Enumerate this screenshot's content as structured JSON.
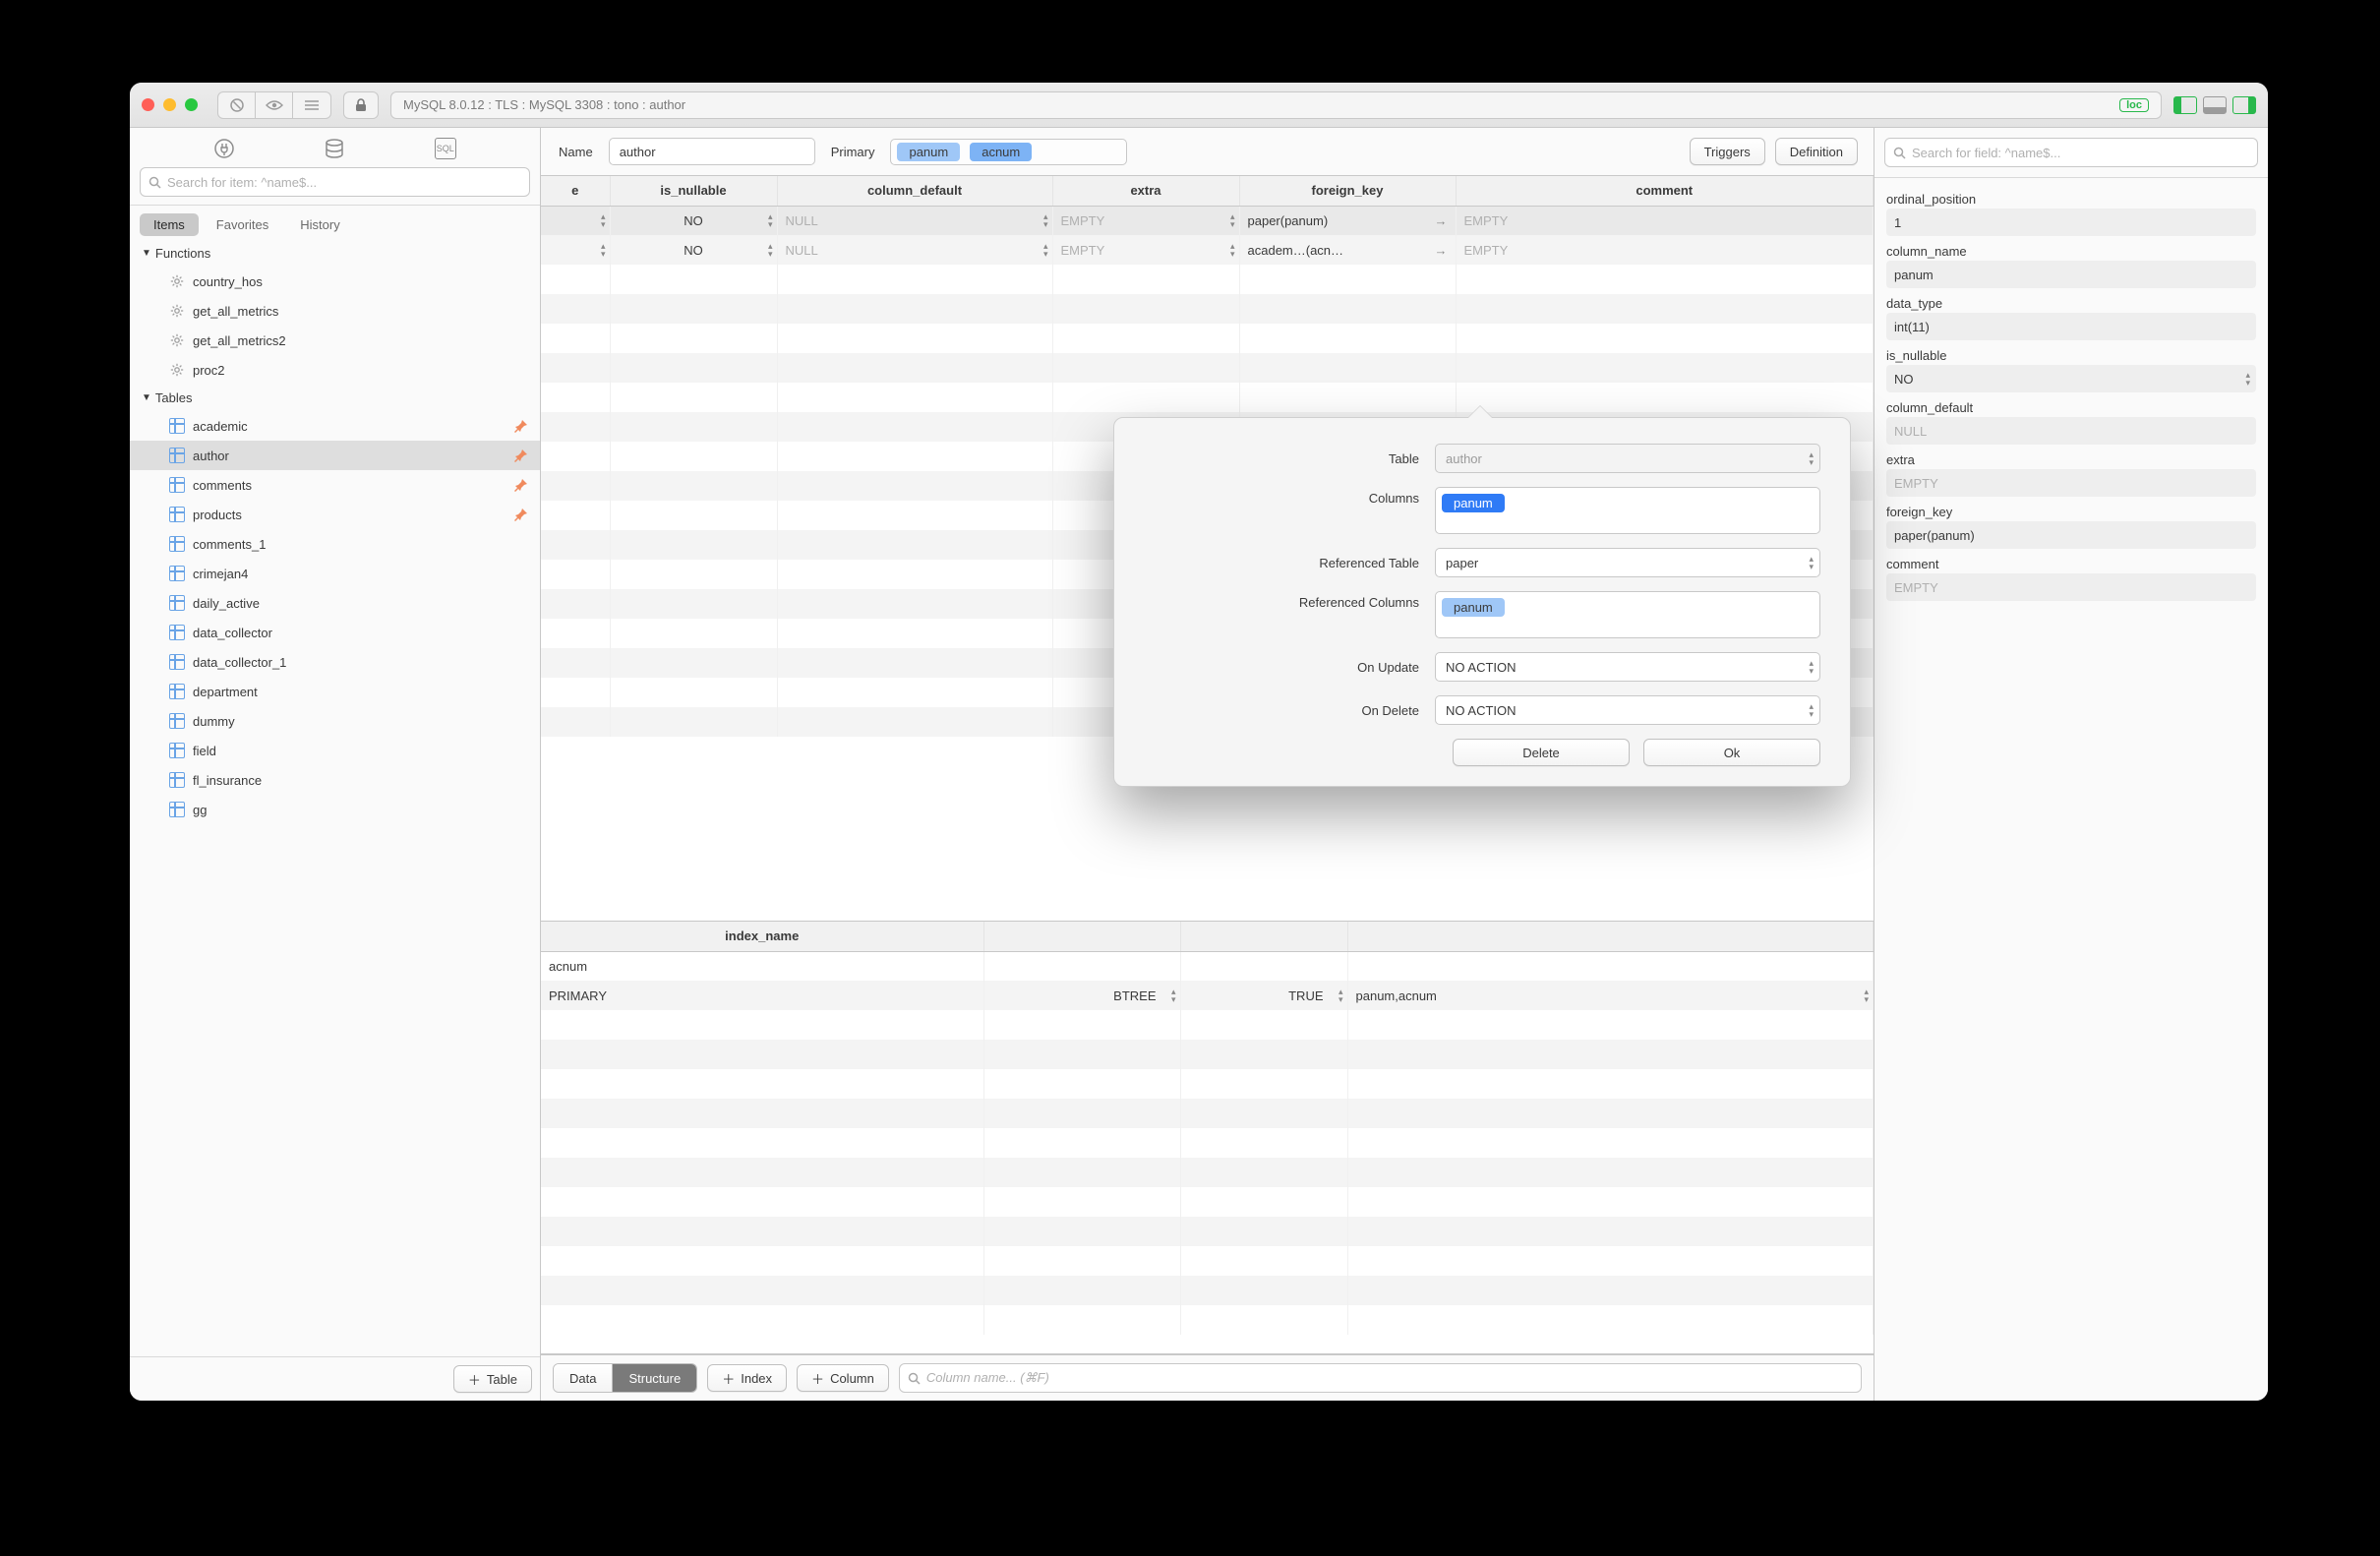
{
  "titlebar": {
    "path": "MySQL 8.0.12 : TLS : MySQL 3308 : tono : author",
    "loc_badge": "loc"
  },
  "sidebar": {
    "search_placeholder": "Search for item: ^name$...",
    "tabs": {
      "items": "Items",
      "favorites": "Favorites",
      "history": "History"
    },
    "functions_header": "Functions",
    "functions": [
      {
        "name": "country_hos"
      },
      {
        "name": "get_all_metrics"
      },
      {
        "name": "get_all_metrics2"
      },
      {
        "name": "proc2"
      }
    ],
    "tables_header": "Tables",
    "tables": [
      {
        "name": "academic",
        "pinned": true
      },
      {
        "name": "author",
        "pinned": true,
        "selected": true
      },
      {
        "name": "comments",
        "pinned": true
      },
      {
        "name": "products",
        "pinned": true
      },
      {
        "name": "comments_1"
      },
      {
        "name": "crimejan4"
      },
      {
        "name": "daily_active"
      },
      {
        "name": "data_collector"
      },
      {
        "name": "data_collector_1"
      },
      {
        "name": "department"
      },
      {
        "name": "dummy"
      },
      {
        "name": "field"
      },
      {
        "name": "fl_insurance"
      },
      {
        "name": "gg"
      }
    ],
    "add_table_btn": "Table"
  },
  "main_top": {
    "name_lbl": "Name",
    "name_value": "author",
    "primary_lbl": "Primary",
    "primary_keys": [
      "panum",
      "acnum"
    ],
    "triggers_btn": "Triggers",
    "definition_btn": "Definition"
  },
  "columns_grid": {
    "headers": {
      "type": "e",
      "is_nullable": "is_nullable",
      "column_default": "column_default",
      "extra": "extra",
      "foreign_key": "foreign_key",
      "comment": "comment"
    },
    "rows": [
      {
        "is_nullable": "NO",
        "column_default": "NULL",
        "extra": "EMPTY",
        "foreign_key": "paper(panum)",
        "comment": "EMPTY",
        "selected": true
      },
      {
        "is_nullable": "NO",
        "column_default": "NULL",
        "extra": "EMPTY",
        "foreign_key": "academ…(acn…",
        "comment": "EMPTY"
      }
    ]
  },
  "index_grid": {
    "headers": {
      "index_name": "index_name"
    },
    "rows": [
      {
        "index_name": "acnum",
        "method": "",
        "unique": "",
        "cols": ""
      },
      {
        "index_name": "PRIMARY",
        "method": "BTREE",
        "unique": "TRUE",
        "cols": "panum,acnum"
      }
    ]
  },
  "footer": {
    "data_btn": "Data",
    "structure_btn": "Structure",
    "add_index_btn": "Index",
    "add_column_btn": "Column",
    "filter_placeholder": "Column name... (⌘F)"
  },
  "inspector": {
    "search_placeholder": "Search for field: ^name$...",
    "fields": {
      "ordinal_position": {
        "label": "ordinal_position",
        "value": "1"
      },
      "column_name": {
        "label": "column_name",
        "value": "panum"
      },
      "data_type": {
        "label": "data_type",
        "value": "int(11)"
      },
      "is_nullable": {
        "label": "is_nullable",
        "value": "NO",
        "stepper": true
      },
      "column_default": {
        "label": "column_default",
        "value": "NULL",
        "dim": true
      },
      "extra": {
        "label": "extra",
        "value": "EMPTY",
        "dim": true
      },
      "foreign_key": {
        "label": "foreign_key",
        "value": "paper(panum)"
      },
      "comment": {
        "label": "comment",
        "value": "EMPTY",
        "dim": true
      }
    }
  },
  "popover": {
    "table_lbl": "Table",
    "table_val": "author",
    "columns_lbl": "Columns",
    "columns_tags": [
      "panum"
    ],
    "ref_table_lbl": "Referenced Table",
    "ref_table_val": "paper",
    "ref_cols_lbl": "Referenced Columns",
    "ref_cols_tags": [
      "panum"
    ],
    "on_update_lbl": "On Update",
    "on_update_val": "NO ACTION",
    "on_delete_lbl": "On Delete",
    "on_delete_val": "NO ACTION",
    "delete_btn": "Delete",
    "ok_btn": "Ok"
  }
}
